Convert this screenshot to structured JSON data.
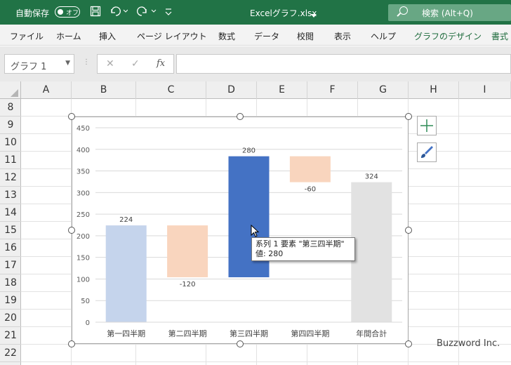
{
  "titlebar": {
    "autosave_label": "自動保存",
    "autosave_state": "オフ",
    "filename": "Excelグラフ.xlsx",
    "search_label": "検索 (Alt+Q)"
  },
  "ribbon": {
    "tabs": [
      "ファイル",
      "ホーム",
      "挿入",
      "ページ レイアウト",
      "数式",
      "データ",
      "校閲",
      "表示",
      "ヘルプ",
      "グラフのデザイン",
      "書式"
    ]
  },
  "formula_bar": {
    "name_box": "グラフ 1",
    "fx_label": "fx",
    "cancel_glyph": "✕",
    "enter_glyph": "✓"
  },
  "grid": {
    "columns": [
      "A",
      "B",
      "C",
      "D",
      "E",
      "F",
      "G",
      "H",
      "I"
    ],
    "rows": [
      "8",
      "9",
      "10",
      "11",
      "12",
      "13",
      "14",
      "15",
      "16",
      "17",
      "18",
      "19",
      "20",
      "21",
      "22"
    ]
  },
  "chart_data": {
    "type": "bar",
    "subtype": "waterfall-stacked",
    "categories": [
      "第一四半期",
      "第二四半期",
      "第三四半期",
      "第四四半期",
      "年間合計"
    ],
    "series": [
      {
        "name": "系列 1",
        "bases": [
          0,
          104,
          104,
          324,
          0
        ],
        "tops": [
          224,
          224,
          384,
          384,
          324
        ]
      }
    ],
    "data_labels": [
      "224",
      "-120",
      "280",
      "-60",
      "324"
    ],
    "colors": [
      "#c5d4ec",
      "#f9d5be",
      "#4472c4",
      "#f9d5be",
      "#e2e2e2"
    ],
    "ylim": [
      0,
      450
    ],
    "yticks": [
      "0",
      "50",
      "100",
      "150",
      "200",
      "250",
      "300",
      "350",
      "400",
      "450"
    ],
    "grid": true,
    "legend": "none"
  },
  "tooltip": {
    "line1": "系列 1 要素 \"第三四半期\"",
    "line2": "値: 280"
  },
  "watermark": "Buzzword Inc."
}
